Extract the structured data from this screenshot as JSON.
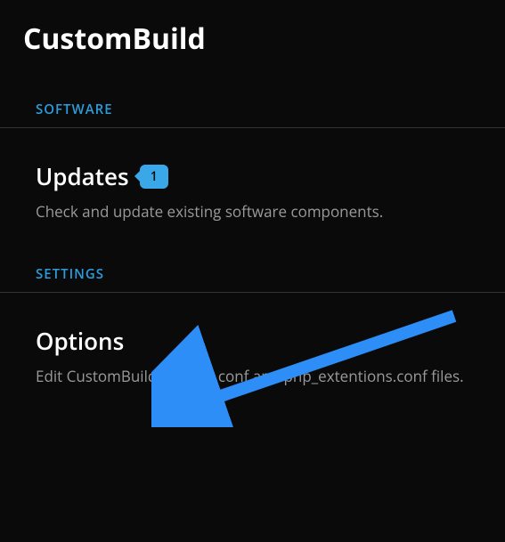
{
  "page": {
    "title": "CustomBuild"
  },
  "sections": [
    {
      "header": "SOFTWARE",
      "item": {
        "title": "Updates",
        "badge": "1",
        "description": "Check and update existing software components."
      }
    },
    {
      "header": "SETTINGS",
      "item": {
        "title": "Options",
        "description": "Edit CustomBuild options.conf and php_extentions.conf files."
      }
    }
  ],
  "colors": {
    "accent": "#2c9cdb",
    "badge": "#3aa8e8",
    "arrow": "#2e8ef7"
  }
}
